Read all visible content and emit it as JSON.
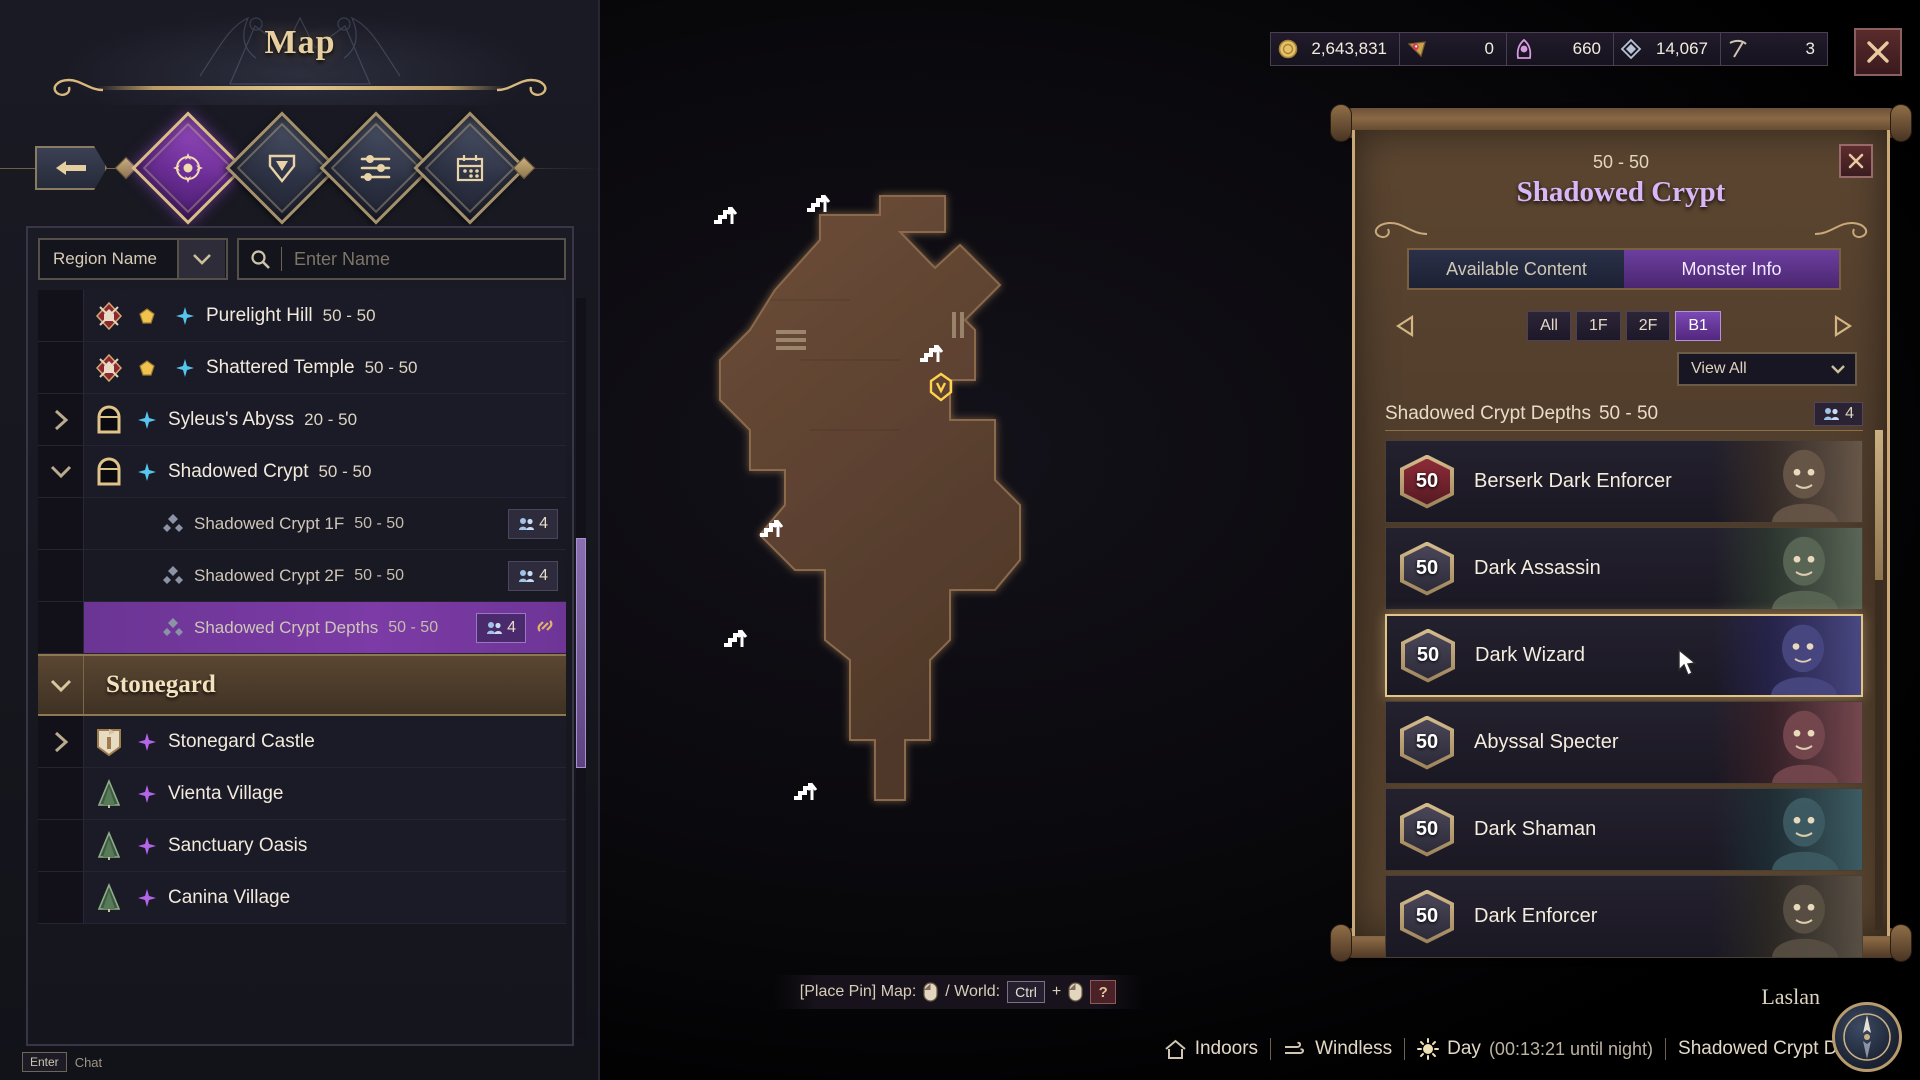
{
  "window": {
    "title": "Map"
  },
  "nav": {
    "back_label": "Back",
    "tabs": [
      {
        "name": "world-map",
        "icon": "compass-icon",
        "active": true
      },
      {
        "name": "quest-map",
        "icon": "chevron-banner-icon",
        "active": false
      },
      {
        "name": "filters",
        "icon": "sliders-icon",
        "active": false
      },
      {
        "name": "calendar",
        "icon": "calendar-icon",
        "active": false
      }
    ]
  },
  "filter": {
    "region_select_value": "Region Name",
    "search_placeholder": "Enter Name",
    "search_value": ""
  },
  "region_list": [
    {
      "name": "Purelight Hill",
      "level": "50 - 50",
      "icon": "field-boss-icon",
      "indent": 0,
      "expander": "none",
      "badge": null,
      "selected": false
    },
    {
      "name": "Shattered Temple",
      "level": "50 - 50",
      "icon": "field-boss-icon",
      "indent": 0,
      "expander": "none",
      "badge": null,
      "selected": false
    },
    {
      "name": "Syleus's Abyss",
      "level": "20 - 50",
      "icon": "dungeon-gate-icon",
      "indent": 0,
      "expander": "collapsed",
      "badge": null,
      "selected": false
    },
    {
      "name": "Shadowed Crypt",
      "level": "50 - 50",
      "icon": "dungeon-gate-icon",
      "indent": 0,
      "expander": "expanded",
      "badge": null,
      "selected": false
    },
    {
      "name": "Shadowed Crypt 1F",
      "level": "50 - 50",
      "icon": "diamond-icon",
      "indent": 1,
      "expander": "none",
      "badge": "4",
      "selected": false
    },
    {
      "name": "Shadowed Crypt 2F",
      "level": "50 - 50",
      "icon": "diamond-icon",
      "indent": 1,
      "expander": "none",
      "badge": "4",
      "selected": false
    },
    {
      "name": "Shadowed Crypt Depths",
      "level": "50 - 50",
      "icon": "diamond-icon",
      "indent": 1,
      "expander": "none",
      "badge": "4",
      "selected": true,
      "link": true
    }
  ],
  "group": {
    "name": "Stonegard",
    "expander": "expanded"
  },
  "group_list": [
    {
      "name": "Stonegard Castle",
      "level": "",
      "icon": "castle-icon",
      "expander": "collapsed"
    },
    {
      "name": "Vienta Village",
      "level": "",
      "icon": "village-icon",
      "expander": "none"
    },
    {
      "name": "Sanctuary Oasis",
      "level": "",
      "icon": "village-icon",
      "expander": "none"
    },
    {
      "name": "Canina Village",
      "level": "",
      "icon": "village-icon",
      "expander": "none"
    }
  ],
  "chat": {
    "key": "Enter",
    "label": "Chat"
  },
  "currencies": [
    {
      "icon": "gold-coin-icon",
      "value": "2,643,831"
    },
    {
      "icon": "red-gem-icon",
      "value": "0"
    },
    {
      "icon": "purple-hood-icon",
      "value": "660"
    },
    {
      "icon": "silver-crest-icon",
      "value": "14,067"
    },
    {
      "icon": "pickaxe-icon",
      "value": "3"
    }
  ],
  "close_button": {
    "label": "Close"
  },
  "detail_panel": {
    "level_range": "50 - 50",
    "title": "Shadowed Crypt",
    "close_label": "Close",
    "tabs": [
      {
        "label": "Available Content",
        "active": false
      },
      {
        "label": "Monster Info",
        "active": true
      }
    ],
    "floors": [
      {
        "label": "All",
        "active": false
      },
      {
        "label": "1F",
        "active": false
      },
      {
        "label": "2F",
        "active": false
      },
      {
        "label": "B1",
        "active": true
      }
    ],
    "view_filter": "View All",
    "list_header": {
      "name": "Shadowed Crypt Depths",
      "level": "50 - 50",
      "party_count": "4"
    },
    "monsters": [
      {
        "level": "50",
        "name": "Berserk Dark Enforcer",
        "elite": true,
        "selected": false,
        "portrait": "undead-knight"
      },
      {
        "level": "50",
        "name": "Dark Assassin",
        "elite": false,
        "selected": false,
        "portrait": "assassin"
      },
      {
        "level": "50",
        "name": "Dark Wizard",
        "elite": false,
        "selected": true,
        "portrait": "wizard"
      },
      {
        "level": "50",
        "name": "Abyssal Specter",
        "elite": false,
        "selected": false,
        "portrait": "specter"
      },
      {
        "level": "50",
        "name": "Dark Shaman",
        "elite": false,
        "selected": false,
        "portrait": "shaman"
      },
      {
        "level": "50",
        "name": "Dark Enforcer",
        "elite": false,
        "selected": false,
        "portrait": "enforcer"
      }
    ]
  },
  "pin_bar": {
    "prefix": "[Place Pin] Map:",
    "middle": "/ World:",
    "ctrl_key": "Ctrl",
    "plus": "+",
    "help": "?"
  },
  "status": {
    "indoors": "Indoors",
    "weather": "Windless",
    "time_of_day": "Day",
    "time_countdown": "(00:13:21 until night)",
    "location": "Shadowed Crypt Depths",
    "region": "Laslan"
  },
  "colors": {
    "accent_purple": "#7c3ba6",
    "gold": "#d7b87e",
    "parchment": "#5c4631"
  }
}
